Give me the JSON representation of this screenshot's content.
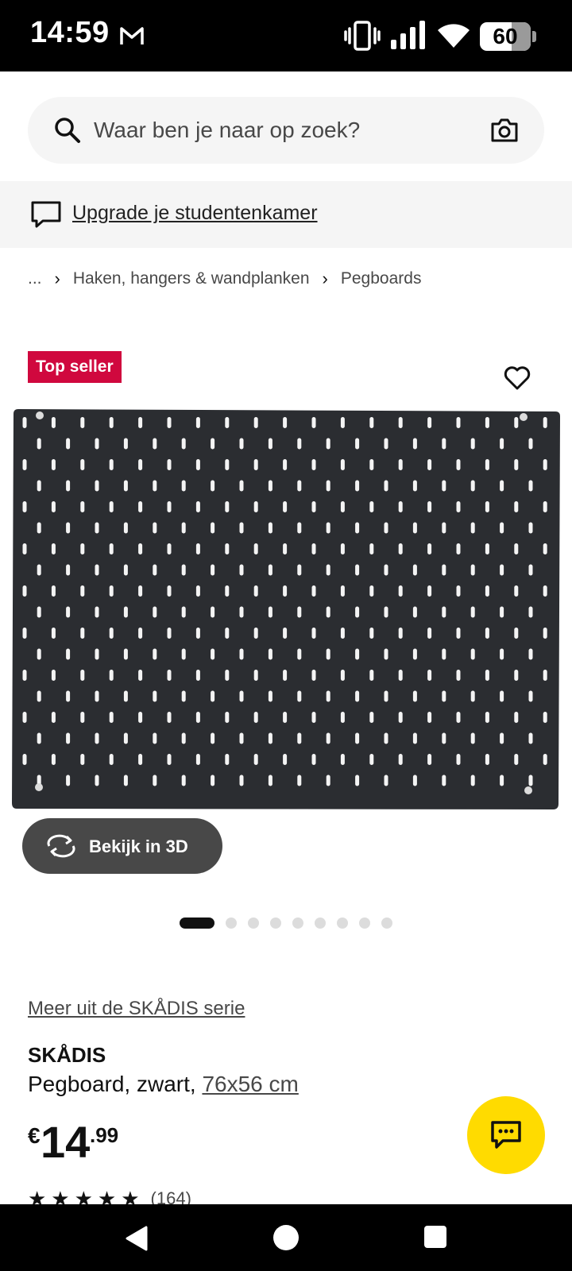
{
  "status_bar": {
    "time": "14:59",
    "battery_level": "60",
    "icons": [
      "gmail-icon",
      "vibrate-icon",
      "signal-icon",
      "wifi-icon",
      "battery-icon"
    ]
  },
  "search": {
    "placeholder": "Waar ben je naar op zoek?",
    "value": ""
  },
  "promo": {
    "text": "Upgrade je studentenkamer"
  },
  "breadcrumb": {
    "items": [
      "...",
      "Haken, hangers & wandplanken",
      "Pegboards"
    ]
  },
  "product": {
    "badge": "Top seller",
    "view_3d_label": "Bekijk in 3D",
    "image_count": 9,
    "active_image_index": 0,
    "series_link": "Meer uit de SKÅDIS serie",
    "name": "SKÅDIS",
    "description": "Pegboard, zwart,",
    "size_link": "76x56 cm",
    "price": {
      "currency": "€",
      "integer": "14",
      "decimal": ".99"
    },
    "rating": {
      "stars": 5,
      "count": "(164)"
    }
  },
  "colors": {
    "badge_bg": "#d0083e",
    "fab_bg": "#ffdb00",
    "pegboard": "#2b2d31",
    "button_dark": "#484848"
  }
}
